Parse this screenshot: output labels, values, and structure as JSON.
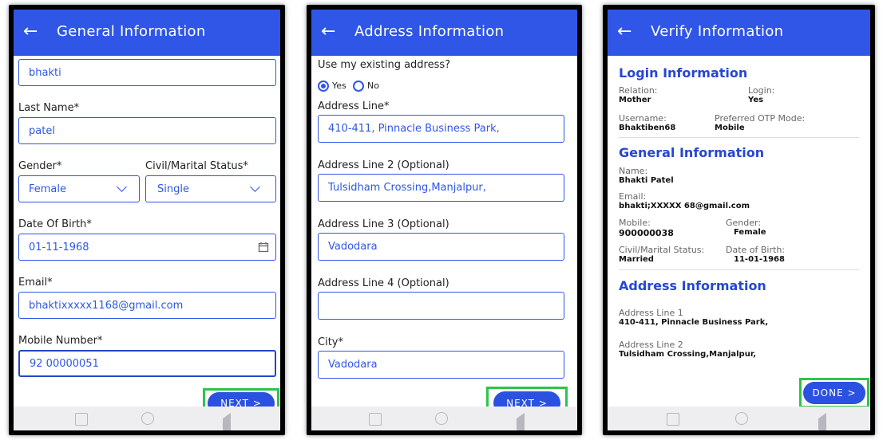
{
  "screens": {
    "general": {
      "title": "General Information",
      "first_name_value": "bhakti",
      "last_name_label": "Last Name*",
      "last_name_value": "patel",
      "gender_label": "Gender*",
      "gender_value": "Female",
      "civil_label": "Civil/Marital Status*",
      "civil_value": "Single",
      "dob_label": "Date Of Birth*",
      "dob_value": "01-11-1968",
      "email_label": "Email*",
      "email_value": "bhaktixxxxx1168@gmail.com",
      "mobile_label": "Mobile Number*",
      "mobile_value": "92 00000051",
      "next_label": "NEXT >"
    },
    "address": {
      "title": "Address Information",
      "existing_question": "Use my existing address?",
      "yes_label": "Yes",
      "no_label": "No",
      "line1_label": "Address Line*",
      "line1_value": "410-411, Pinnacle Business Park,",
      "line2_label": "Address Line 2 (Optional)",
      "line2_value": "Tulsidham Crossing,Manjalpur,",
      "line3_label": "Address Line 3 (Optional)",
      "line3_value": "Vadodara",
      "line4_label": "Address Line 4 (Optional)",
      "line4_value": "",
      "city_label": "City*",
      "city_value": "Vadodara",
      "next_label": "NEXT >"
    },
    "verify": {
      "title": "Verify Information",
      "login_heading": "Login Information",
      "relation_key": "Relation:",
      "relation_value": "Mother",
      "login_key": "Login:",
      "login_value": "Yes",
      "username_key": "Username:",
      "username_value": "Bhaktiben68",
      "otp_key": "Preferred OTP Mode:",
      "otp_value": "Mobile",
      "general_heading": "General Information",
      "name_key": "Name:",
      "name_value": "Bhakti Patel",
      "email_key": "Email:",
      "email_value": "bhakti;XXXXX 68@gmail.com",
      "mobile_key": "Mobile:",
      "mobile_value": "900000038",
      "gender_key": "Gender:",
      "gender_value": "Female",
      "civil_key": "Civil/Marital Status:",
      "civil_value": "Married",
      "dob_key": "Date of Birth:",
      "dob_value": "11-01-1968",
      "address_heading": "Address Information",
      "addr1_key": "Address Line 1",
      "addr1_value": "410-411, Pinnacle Business Park,",
      "addr2_key": "Address Line 2",
      "addr2_value": "Tulsidham Crossing,Manjalpur,",
      "done_label": "DONE >"
    }
  },
  "icons": {
    "back": "arrow-left-icon",
    "calendar": "calendar-icon",
    "dropdown": "chevron-down-icon",
    "nav_recent": "square-icon",
    "nav_home": "circle-icon",
    "nav_back": "triangle-back-icon"
  },
  "colors": {
    "appbar": "#2f56e6",
    "accent": "#2f56e6",
    "button": "#2b51e0",
    "highlight": "#2ec449",
    "section_heading": "#2647d2"
  }
}
